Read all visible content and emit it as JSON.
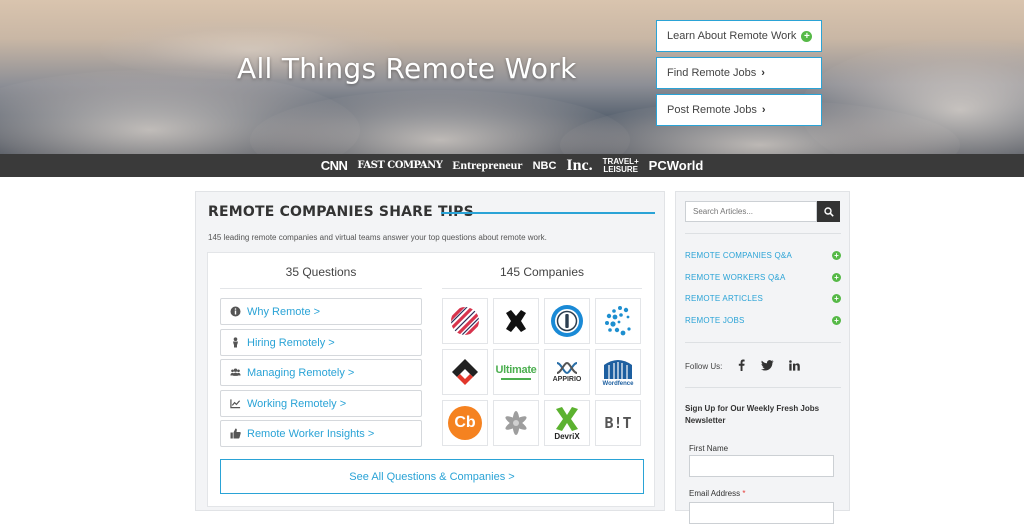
{
  "hero": {
    "title": "All Things Remote Work",
    "buttons": [
      {
        "label": "Learn About Remote Work",
        "icon": "plus-circle-icon"
      },
      {
        "label": "Find Remote Jobs",
        "icon": "chevron-right-icon"
      },
      {
        "label": "Post Remote Jobs",
        "icon": "chevron-right-icon"
      }
    ]
  },
  "press": [
    "CNN",
    "FAST COMPANY",
    "Entrepreneur",
    "NBC",
    "Inc.",
    "TRAVEL+ LEISURE",
    "PCWorld"
  ],
  "main": {
    "title": "REMOTE COMPANIES SHARE TIPS",
    "subtitle": "145 leading remote companies and virtual teams answer your top questions about remote work.",
    "questions_header": "35 Questions",
    "companies_header": "145 Companies",
    "questions": [
      {
        "label": "Why Remote >",
        "icon": "info-circle-icon"
      },
      {
        "label": "Hiring Remotely >",
        "icon": "person-icon"
      },
      {
        "label": "Managing Remotely >",
        "icon": "users-icon"
      },
      {
        "label": "Working Remotely >",
        "icon": "line-chart-icon"
      },
      {
        "label": "Remote Worker Insights >",
        "icon": "thumbs-up-icon"
      }
    ],
    "companies": [
      {
        "name": "stripes-logo",
        "text": ""
      },
      {
        "name": "x-logo",
        "text": ""
      },
      {
        "name": "1password-logo",
        "text": ""
      },
      {
        "name": "globe-dots-logo",
        "text": ""
      },
      {
        "name": "house-logo",
        "text": ""
      },
      {
        "name": "ultimate-logo",
        "text": "Ultimate"
      },
      {
        "name": "appirio-logo",
        "text": "APPIRIO"
      },
      {
        "name": "wordfence-logo",
        "text": "Wordfence"
      },
      {
        "name": "cb-logo",
        "text": "Cb"
      },
      {
        "name": "flower-logo",
        "text": ""
      },
      {
        "name": "devrix-logo",
        "text": "DevriX"
      },
      {
        "name": "bit-logo",
        "text": "B!T"
      }
    ],
    "see_all": "See All Questions & Companies >"
  },
  "sidebar": {
    "search_placeholder": "Search Articles...",
    "links": [
      "REMOTE COMPANIES Q&A",
      "REMOTE WORKERS Q&A",
      "REMOTE ARTICLES",
      "REMOTE JOBS"
    ],
    "follow_label": "Follow Us:",
    "socials": [
      "facebook-icon",
      "twitter-icon",
      "linkedin-icon"
    ],
    "newsletter_title": "Sign Up for Our Weekly Fresh Jobs Newsletter",
    "first_name_label": "First Name",
    "email_label": "Email Address",
    "email_required": "*"
  },
  "colors": {
    "accent": "#2aa3d6",
    "green": "#56b947",
    "press_bar": "#3a3a3a"
  }
}
